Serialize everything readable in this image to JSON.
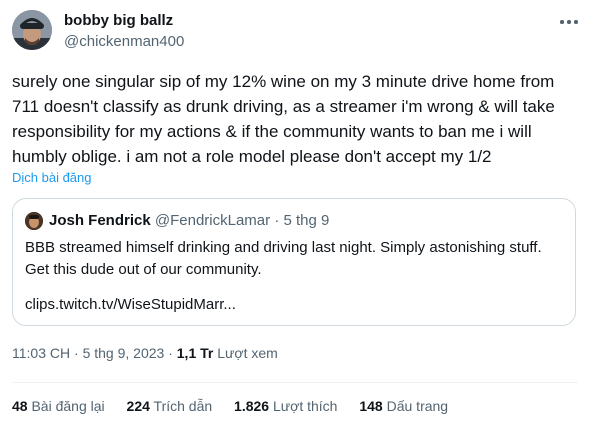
{
  "author": {
    "name": "bobby big ballz",
    "handle": "@chickenman400"
  },
  "tweet": {
    "lines": [
      "surely one singular sip of my 12% wine on my 3 minute drive home from",
      "711 doesn't classify as drunk driving, as a streamer i'm wrong & will take",
      "responsibility for my actions & if the community wants to ban me i will",
      "humbly oblige. i am not a role model please don't accept my 1/2"
    ],
    "translate_label": "Dịch bài đăng"
  },
  "quote": {
    "name": "Josh Fendrick",
    "handle": "@FendrickLamar",
    "dot": "·",
    "date": "5 thg 9",
    "lines": [
      "BBB streamed himself drinking and driving last night. Simply astonishing stuff.",
      "Get this dude out of our community."
    ],
    "link": "clips.twitch.tv/WiseStupidMarr..."
  },
  "meta": {
    "time": "11:03 CH",
    "dot": "·",
    "date": "5 thg 9, 2023",
    "views_count": "1,1 Tr",
    "views_label": "Lượt xem"
  },
  "stats": {
    "reposts_count": "48",
    "reposts_label": "Bài đăng lại",
    "quotes_count": "224",
    "quotes_label": "Trích dẫn",
    "likes_count": "1.826",
    "likes_label": "Lượt thích",
    "bookmarks_count": "148",
    "bookmarks_label": "Dấu trang"
  },
  "icons": {
    "more": "more-horizontal-icon"
  },
  "colors": {
    "text": "#0f1419",
    "secondary": "#536471",
    "link": "#1d9bf0",
    "border": "#cfd9de"
  }
}
